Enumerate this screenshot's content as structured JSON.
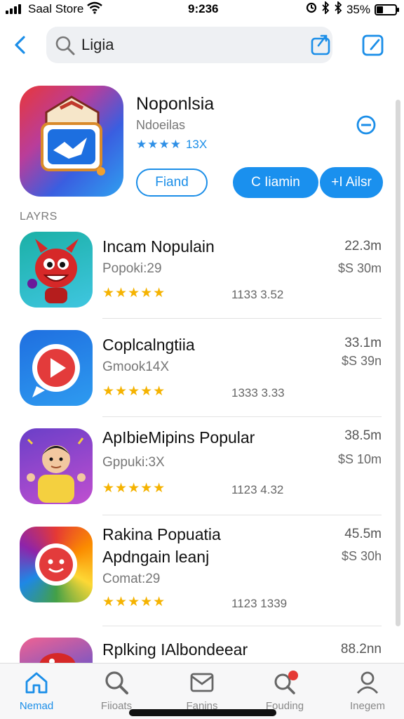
{
  "status_bar": {
    "carrier": "Saal Store",
    "time": "9:236",
    "battery": "35%"
  },
  "search": {
    "query": "Ligia"
  },
  "featured": {
    "title": "Noponlsia",
    "subtitle": "Ndoeilas",
    "rating_stars": "★★★★",
    "rating_count": "13X",
    "buttons": {
      "outline": "Fiand",
      "primary": "C Iiamin",
      "secondary": "+I Ailsr"
    }
  },
  "section_label": "LAYRS",
  "apps": [
    {
      "name": "Incam Nopulain",
      "sub": "Popoki:29",
      "stars": "★★★★★",
      "meta": "1133 3.52",
      "size": "22.3m",
      "price": "$S 30m",
      "icon": "devil-mascot-icon"
    },
    {
      "name": "Coplcalngtiia",
      "sub": "Gmook14X",
      "stars": "★★★★★",
      "meta": "1333 3.33",
      "size": "33.1m",
      "price": "$S 39n",
      "icon": "play-video-icon"
    },
    {
      "name": "ApIbieMipins Popular",
      "sub": "Gppuki:3X",
      "stars": "★★★★★",
      "meta": "1123 4.32",
      "size": "38.5m",
      "price": "$S 10m",
      "icon": "kid-avatar-icon"
    },
    {
      "name": "Rakina Popuatia",
      "name2": "Apdngain leanj",
      "sub": "Comat:29",
      "stars": "★★★★★",
      "meta": "1123 1339",
      "size": "45.5m",
      "price": "$S 30h",
      "icon": "rainbow-face-icon"
    },
    {
      "name": "Rplking IAlbondeear",
      "size": "88.2nn",
      "icon": "red-creature-icon"
    }
  ],
  "tabs": [
    {
      "label": "Nemad",
      "icon": "home-icon"
    },
    {
      "label": "Fiioats",
      "icon": "search-icon"
    },
    {
      "label": "Fanins",
      "icon": "mail-icon"
    },
    {
      "label": "Fouding",
      "icon": "search-badge-icon"
    },
    {
      "label": "Inegem",
      "icon": "profile-icon"
    }
  ],
  "colors": {
    "accent": "#1a90ee",
    "star": "#f5b301"
  }
}
